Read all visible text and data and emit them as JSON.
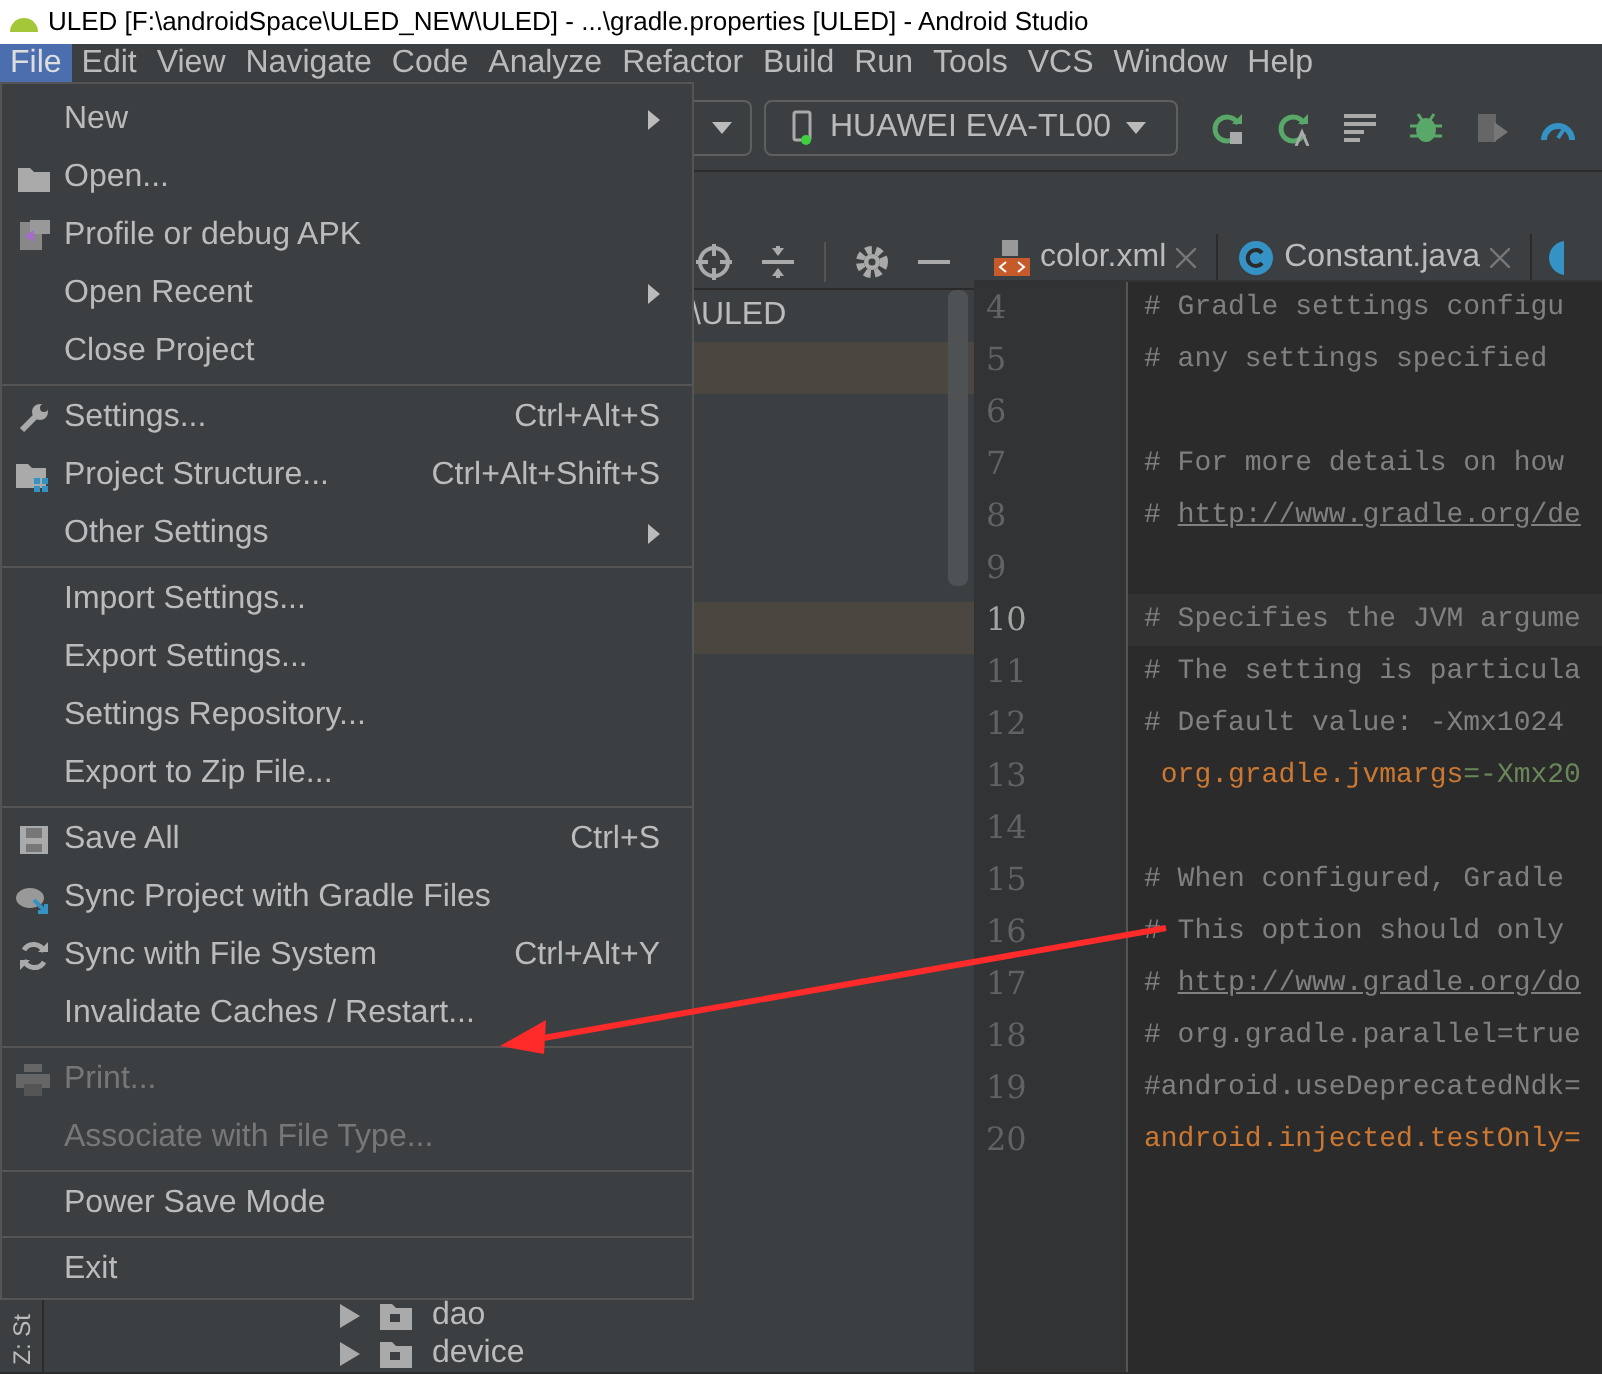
{
  "window": {
    "title": "ULED [F:\\androidSpace\\ULED_NEW\\ULED] - ...\\gradle.properties [ULED] - Android Studio"
  },
  "menu_bar": [
    {
      "label": "File",
      "selected": true
    },
    {
      "label": "Edit",
      "selected": false
    },
    {
      "label": "View",
      "selected": false
    },
    {
      "label": "Navigate",
      "selected": false
    },
    {
      "label": "Code",
      "selected": false
    },
    {
      "label": "Analyze",
      "selected": false
    },
    {
      "label": "Refactor",
      "selected": false
    },
    {
      "label": "Build",
      "selected": false
    },
    {
      "label": "Run",
      "selected": false
    },
    {
      "label": "Tools",
      "selected": false
    },
    {
      "label": "VCS",
      "selected": false
    },
    {
      "label": "Window",
      "selected": false
    },
    {
      "label": "Help",
      "selected": false
    }
  ],
  "toolbar": {
    "device": "HUAWEI EVA-TL00"
  },
  "file_menu": [
    {
      "label": "New",
      "submenu": true,
      "disabled": false
    },
    {
      "label": "Open...",
      "kind": "folder",
      "disabled": false
    },
    {
      "label": "Profile or debug APK",
      "kind": "apk",
      "disabled": false
    },
    {
      "label": "Open Recent",
      "submenu": true,
      "disabled": false
    },
    {
      "label": "Close Project",
      "disabled": false,
      "separator_after": true
    },
    {
      "label": "Settings...",
      "kind": "wrench",
      "shortcut": "Ctrl+Alt+S",
      "disabled": false
    },
    {
      "label": "Project Structure...",
      "kind": "structure",
      "shortcut": "Ctrl+Alt+Shift+S",
      "disabled": false
    },
    {
      "label": "Other Settings",
      "submenu": true,
      "disabled": false,
      "separator_after": true
    },
    {
      "label": "Import Settings...",
      "disabled": false
    },
    {
      "label": "Export Settings...",
      "disabled": false
    },
    {
      "label": "Settings Repository...",
      "disabled": false
    },
    {
      "label": "Export to Zip File...",
      "disabled": false,
      "separator_after": true
    },
    {
      "label": "Save All",
      "kind": "save",
      "shortcut": "Ctrl+S",
      "disabled": false
    },
    {
      "label": "Sync Project with Gradle Files",
      "kind": "gradle",
      "disabled": false
    },
    {
      "label": "Sync with File System",
      "kind": "sync",
      "shortcut": "Ctrl+Alt+Y",
      "disabled": false
    },
    {
      "label": "Invalidate Caches / Restart...",
      "disabled": false,
      "separator_after": true
    },
    {
      "label": "Print...",
      "kind": "print",
      "disabled": true
    },
    {
      "label": "Associate with File Type...",
      "disabled": true,
      "separator_after": true
    },
    {
      "label": "Power Save Mode",
      "disabled": false,
      "separator_after": true
    },
    {
      "label": "Exit",
      "disabled": false
    }
  ],
  "project_panel": {
    "path": "\\ULED",
    "tree": [
      {
        "label": "dao"
      },
      {
        "label": "device"
      }
    ],
    "side_tab": "Z: St"
  },
  "editor_tabs": [
    {
      "label": "color.xml",
      "kind": "xml"
    },
    {
      "label": "Constant.java",
      "kind": "class"
    }
  ],
  "code_lines": [
    {
      "number": "4",
      "kind": "comment",
      "text": "# Gradle settings configu"
    },
    {
      "number": "5",
      "kind": "comment",
      "text": "# any settings specified"
    },
    {
      "number": "6",
      "kind": "blank"
    },
    {
      "number": "7",
      "kind": "comment",
      "text": "# For more details on how"
    },
    {
      "number": "8",
      "kind": "link",
      "text": "# ",
      "link": "http://www.gradle.org/de"
    },
    {
      "number": "9",
      "kind": "blank"
    },
    {
      "number": "10",
      "kind": "comment",
      "text": "# Specifies the JVM argume",
      "current": true
    },
    {
      "number": "11",
      "kind": "comment",
      "text": "# The setting is particula"
    },
    {
      "number": "12",
      "kind": "comment",
      "text": "# Default value: -Xmx1024"
    },
    {
      "number": "13",
      "kind": "property",
      "key": " org.gradle.jvmargs",
      "value": "=-Xmx20"
    },
    {
      "number": "14",
      "kind": "blank"
    },
    {
      "number": "15",
      "kind": "comment",
      "text": "# When configured, Gradle"
    },
    {
      "number": "16",
      "kind": "comment",
      "text": "# This option should only"
    },
    {
      "number": "17",
      "kind": "link",
      "text": "# ",
      "link": "http://www.gradle.org/do"
    },
    {
      "number": "18",
      "kind": "comment",
      "text": "# org.gradle.parallel=true"
    },
    {
      "number": "19",
      "kind": "comment",
      "text": "#android.useDeprecatedNdk="
    },
    {
      "number": "20",
      "kind": "property",
      "key": "android.injected.testOnly="
    }
  ]
}
